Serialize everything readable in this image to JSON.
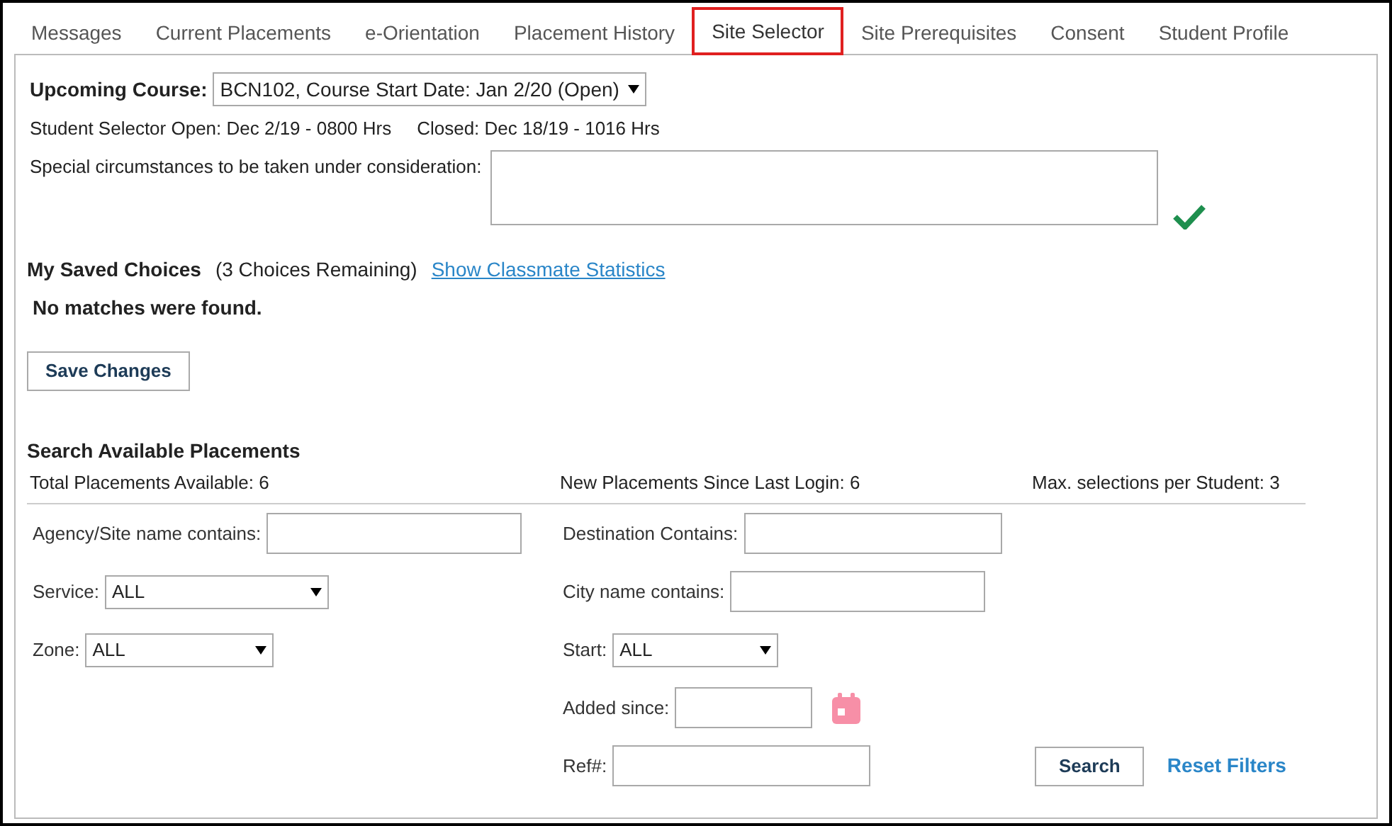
{
  "tabs": [
    {
      "label": "Messages",
      "selected": false
    },
    {
      "label": "Current Placements",
      "selected": false
    },
    {
      "label": "e-Orientation",
      "selected": false
    },
    {
      "label": "Placement History",
      "selected": false
    },
    {
      "label": "Site Selector",
      "selected": true
    },
    {
      "label": "Site Prerequisites",
      "selected": false
    },
    {
      "label": "Consent",
      "selected": false
    },
    {
      "label": "Student Profile",
      "selected": false
    }
  ],
  "course": {
    "label": "Upcoming Course:",
    "value": "BCN102, Course Start Date: Jan 2/20 (Open)"
  },
  "schedule": {
    "open": "Student Selector Open: Dec 2/19 - 0800 Hrs",
    "closed": "Closed: Dec 18/19 - 1016 Hrs"
  },
  "special": {
    "label": "Special circumstances to be taken under consideration:",
    "saved": true
  },
  "saved_choices": {
    "title": "My Saved Choices",
    "remaining": "(3 Choices Remaining)",
    "link": "Show Classmate Statistics",
    "message": "No matches were found.",
    "button": "Save Changes"
  },
  "search": {
    "title": "Search Available Placements",
    "stats": [
      "Total Placements Available: 6",
      "New Placements Since Last Login: 6",
      "Max. selections per Student: 3"
    ],
    "filters_left": [
      {
        "kind": "text",
        "label": "Agency/Site name contains:"
      },
      {
        "kind": "select",
        "label": "Service:",
        "value": "ALL"
      },
      {
        "kind": "select",
        "label": "Zone:",
        "value": "ALL"
      }
    ],
    "filters_right": [
      {
        "kind": "text",
        "label": "Destination Contains:"
      },
      {
        "kind": "text",
        "label": "City name contains:"
      },
      {
        "kind": "select",
        "label": "Start:",
        "value": "ALL"
      },
      {
        "kind": "date",
        "label": "Added since:"
      },
      {
        "kind": "text",
        "label": "Ref#:"
      }
    ],
    "search_button": "Search",
    "reset_link": "Reset Filters"
  }
}
